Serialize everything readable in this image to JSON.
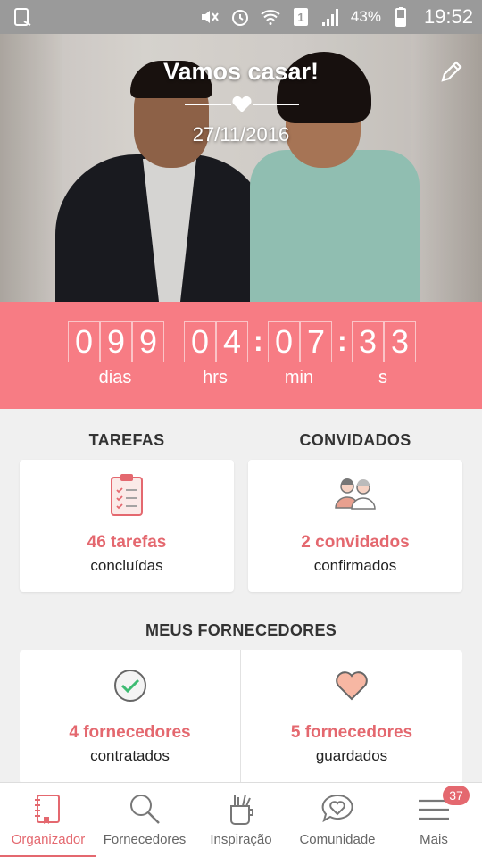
{
  "status_bar": {
    "battery": "43%",
    "time": "19:52",
    "icons": [
      "screen-rotate-icon",
      "mute-icon",
      "alarm-icon",
      "wifi-icon",
      "sim-icon",
      "signal-icon",
      "battery-icon"
    ]
  },
  "hero": {
    "title": "Vamos casar!",
    "date": "27/11/2016"
  },
  "countdown": {
    "days_digits": [
      "0",
      "9",
      "9"
    ],
    "hours_digits": [
      "0",
      "4"
    ],
    "minutes_digits": [
      "0",
      "7"
    ],
    "seconds_digits": [
      "3",
      "3"
    ],
    "labels": {
      "days": "dias",
      "hours": "hrs",
      "minutes": "min",
      "seconds": "s"
    }
  },
  "tasks": {
    "title": "TAREFAS",
    "count_text": "46 tarefas",
    "sub_text": "concluídas"
  },
  "guests": {
    "title": "CONVIDADOS",
    "count_text": "2 convidados",
    "sub_text": "confirmados"
  },
  "vendors": {
    "title": "MEUS FORNECEDORES",
    "hired": {
      "count_text": "4 fornecedores",
      "sub_text": "contratados"
    },
    "saved": {
      "count_text": "5 fornecedores",
      "sub_text": "guardados"
    }
  },
  "bottom_nav": {
    "items": [
      {
        "label": "Organizador",
        "icon": "notebook-icon"
      },
      {
        "label": "Fornecedores",
        "icon": "search-icon"
      },
      {
        "label": "Inspiração",
        "icon": "inspiration-icon"
      },
      {
        "label": "Comunidade",
        "icon": "chat-heart-icon"
      },
      {
        "label": "Mais",
        "icon": "menu-icon",
        "badge": "37"
      }
    ]
  },
  "colors": {
    "accent": "#e4686f",
    "countdown_bg": "#f77c84",
    "status_bar": "#9a9a9a"
  }
}
